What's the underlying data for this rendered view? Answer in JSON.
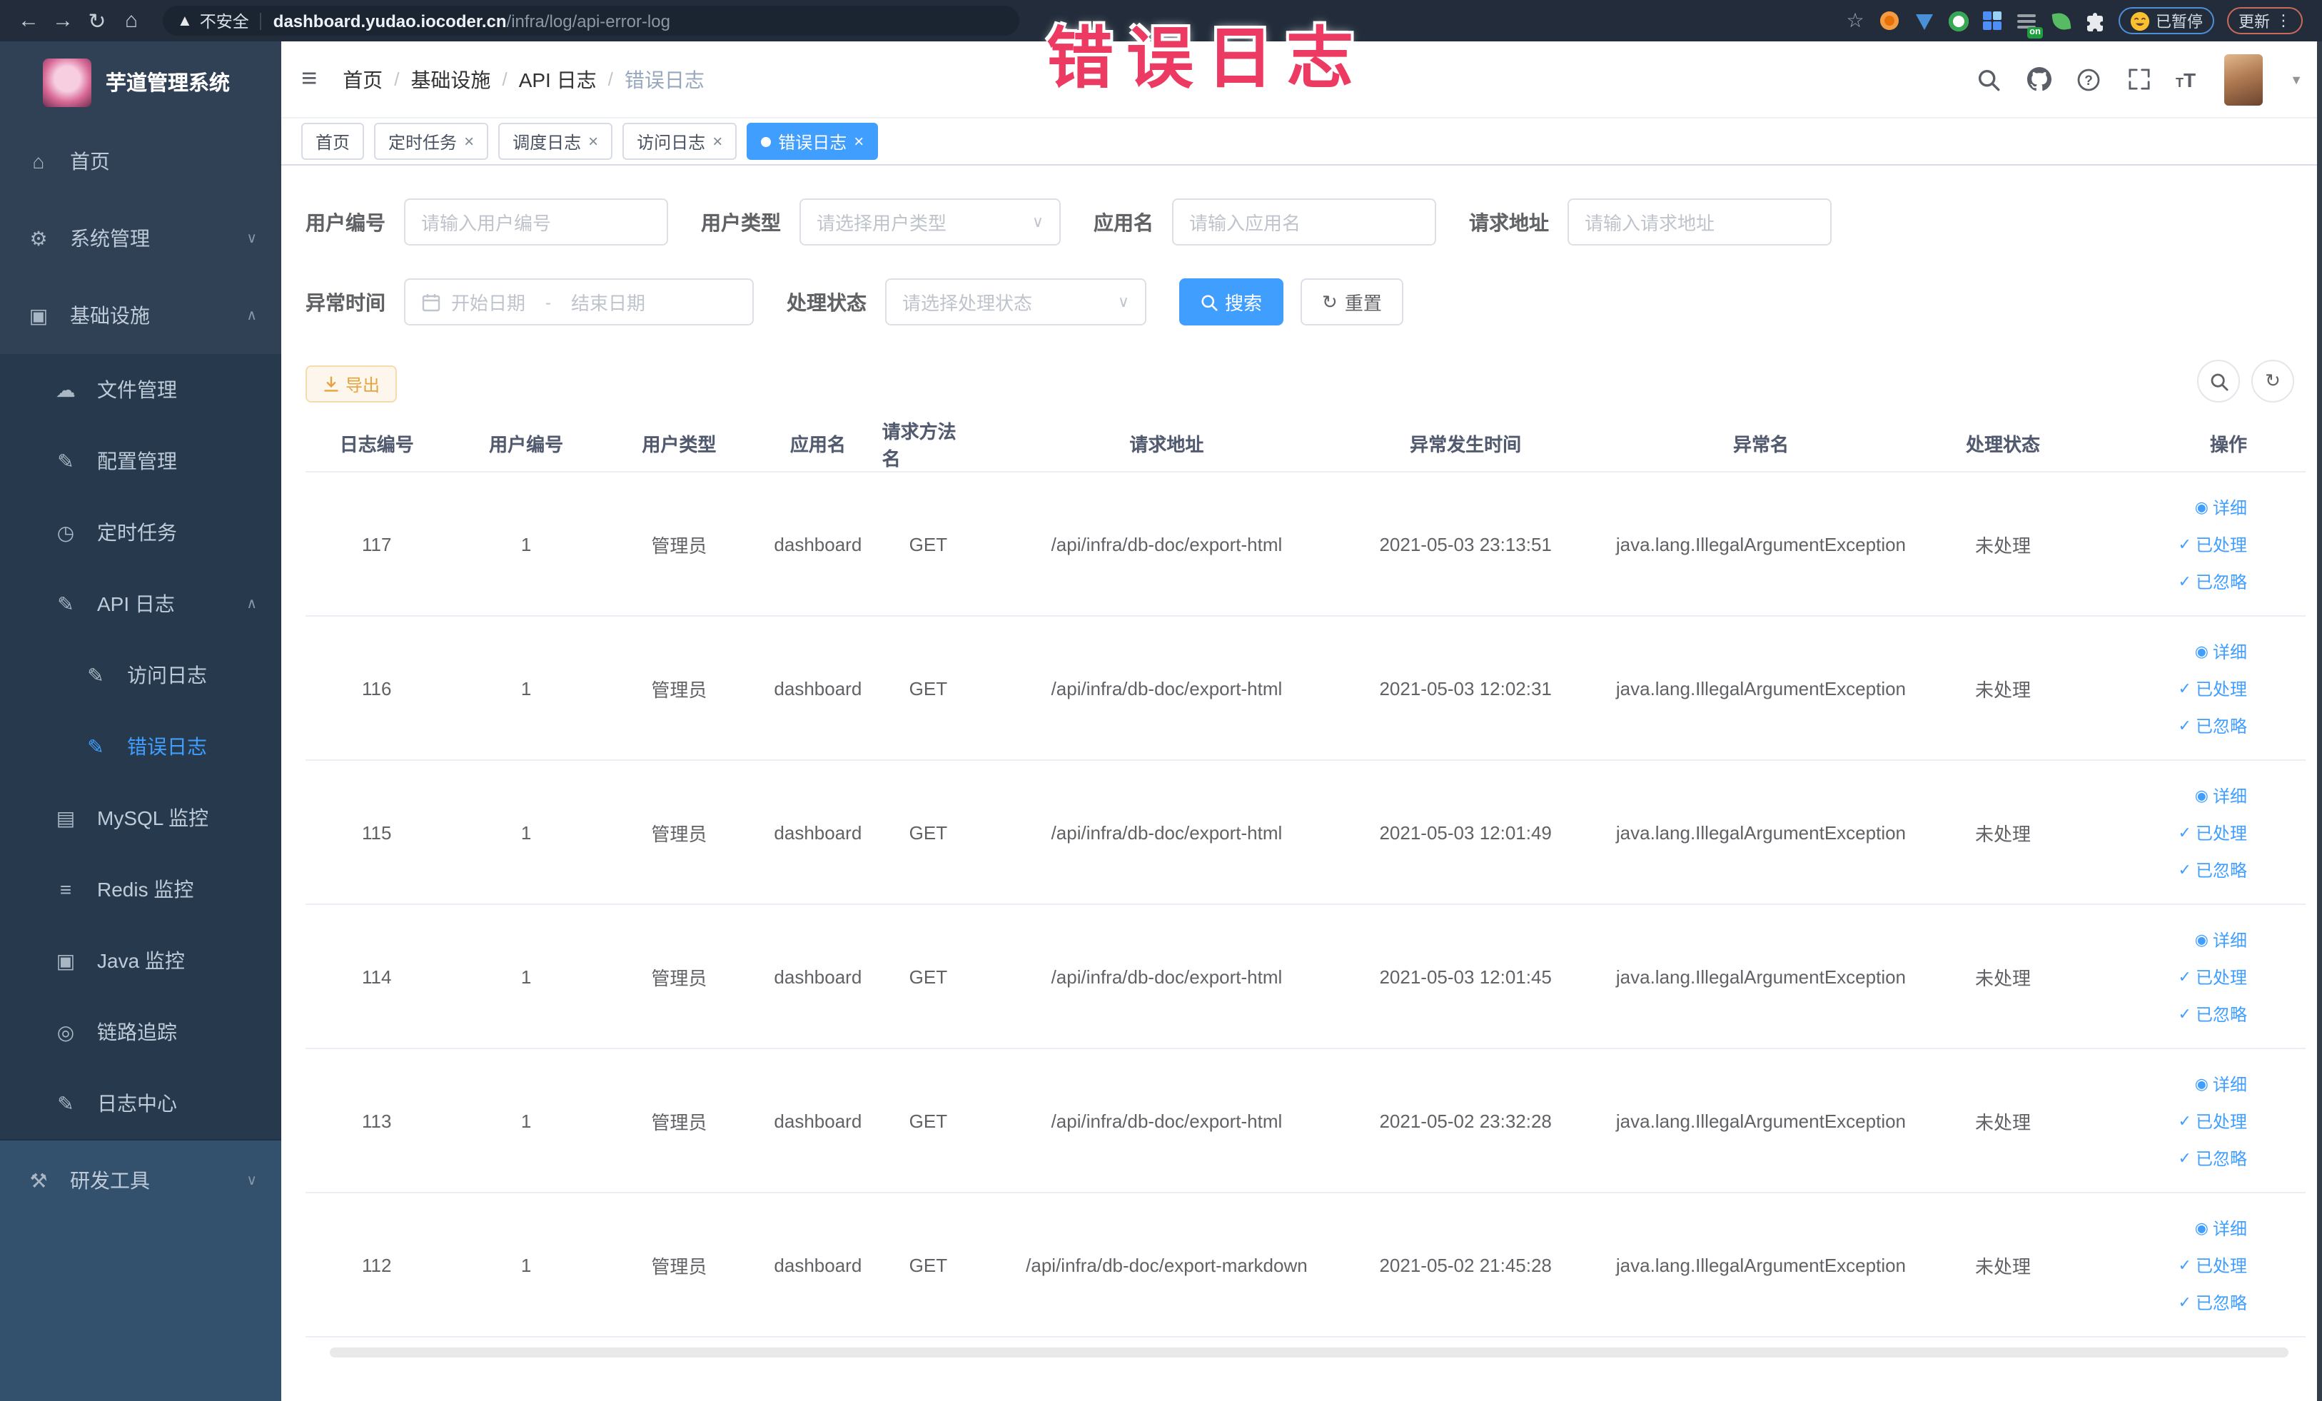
{
  "browser": {
    "security_label": "不安全",
    "url_host": "dashboard.yudao.iocoder.cn",
    "url_path": "/infra/log/api-error-log",
    "extension_on_badge": "on",
    "paused_badge_label": "已暂停",
    "update_button_label": "更新"
  },
  "watermark_text": "错误日志",
  "colors": {
    "primary": "#409eff",
    "watermark_pink": "#ec3a62",
    "warning_text": "#e6a23c",
    "warning_bg": "#fdf6ec",
    "warning_border": "#f5dcab",
    "sidebar_bg": "#304156",
    "sidebar_submenu_bg": "#273a4d",
    "sidebar_bottom_bg": "#33506d",
    "browser_bar_bg": "#222c3a"
  },
  "sidebar": {
    "title": "芋道管理系统",
    "items": [
      {
        "label": "首页"
      },
      {
        "label": "系统管理"
      },
      {
        "label": "基础设施"
      },
      {
        "label": "文件管理"
      },
      {
        "label": "配置管理"
      },
      {
        "label": "定时任务"
      },
      {
        "label": "API 日志"
      },
      {
        "label": "访问日志"
      },
      {
        "label": "错误日志"
      },
      {
        "label": "MySQL 监控"
      },
      {
        "label": "Redis 监控"
      },
      {
        "label": "Java 监控"
      },
      {
        "label": "链路追踪"
      },
      {
        "label": "日志中心"
      },
      {
        "label": "研发工具"
      }
    ]
  },
  "header": {
    "breadcrumb": [
      "首页",
      "基础设施",
      "API 日志",
      "错误日志"
    ],
    "breadcrumb_separator": "/"
  },
  "tabs": [
    {
      "label": "首页"
    },
    {
      "label": "定时任务"
    },
    {
      "label": "调度日志"
    },
    {
      "label": "访问日志"
    },
    {
      "label": "错误日志"
    }
  ],
  "filters": {
    "user_id": {
      "label": "用户编号",
      "placeholder": "请输入用户编号"
    },
    "user_type": {
      "label": "用户类型",
      "placeholder": "请选择用户类型"
    },
    "app_name": {
      "label": "应用名",
      "placeholder": "请输入应用名"
    },
    "request_url": {
      "label": "请求地址",
      "placeholder": "请输入请求地址"
    },
    "exception_time": {
      "label": "异常时间",
      "start_placeholder": "开始日期",
      "separator": "-",
      "end_placeholder": "结束日期"
    },
    "process_status": {
      "label": "处理状态",
      "placeholder": "请选择处理状态"
    },
    "search_button": "搜索",
    "reset_button": "重置"
  },
  "toolbar": {
    "export_label": "导出"
  },
  "table": {
    "columns": [
      "日志编号",
      "用户编号",
      "用户类型",
      "应用名",
      "请求方法名",
      "请求地址",
      "异常发生时间",
      "异常名",
      "处理状态",
      "操作"
    ],
    "action_labels": [
      "详细",
      "已处理",
      "已忽略"
    ],
    "rows": [
      {
        "log_id": "117",
        "user_id": "1",
        "user_type": "管理员",
        "app_name": "dashboard",
        "method": "GET",
        "url": "/api/infra/db-doc/export-html",
        "time": "2021-05-03 23:13:51",
        "exception": "java.lang.IllegalArgumentException",
        "status": "未处理"
      },
      {
        "log_id": "116",
        "user_id": "1",
        "user_type": "管理员",
        "app_name": "dashboard",
        "method": "GET",
        "url": "/api/infra/db-doc/export-html",
        "time": "2021-05-03 12:02:31",
        "exception": "java.lang.IllegalArgumentException",
        "status": "未处理"
      },
      {
        "log_id": "115",
        "user_id": "1",
        "user_type": "管理员",
        "app_name": "dashboard",
        "method": "GET",
        "url": "/api/infra/db-doc/export-html",
        "time": "2021-05-03 12:01:49",
        "exception": "java.lang.IllegalArgumentException",
        "status": "未处理"
      },
      {
        "log_id": "114",
        "user_id": "1",
        "user_type": "管理员",
        "app_name": "dashboard",
        "method": "GET",
        "url": "/api/infra/db-doc/export-html",
        "time": "2021-05-03 12:01:45",
        "exception": "java.lang.IllegalArgumentException",
        "status": "未处理"
      },
      {
        "log_id": "113",
        "user_id": "1",
        "user_type": "管理员",
        "app_name": "dashboard",
        "method": "GET",
        "url": "/api/infra/db-doc/export-html",
        "time": "2021-05-02 23:32:28",
        "exception": "java.lang.IllegalArgumentException",
        "status": "未处理"
      },
      {
        "log_id": "112",
        "user_id": "1",
        "user_type": "管理员",
        "app_name": "dashboard",
        "method": "GET",
        "url": "/api/infra/db-doc/export-markdown",
        "time": "2021-05-02 21:45:28",
        "exception": "java.lang.IllegalArgumentException",
        "status": "未处理"
      }
    ]
  }
}
